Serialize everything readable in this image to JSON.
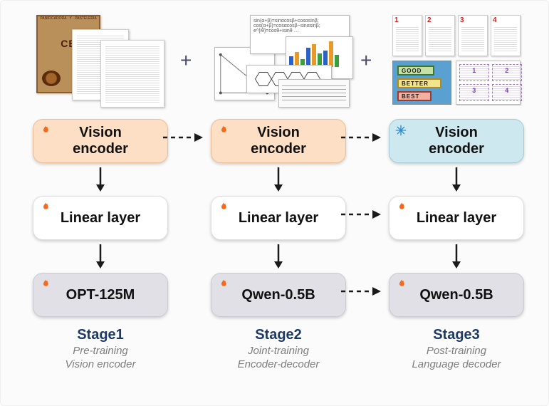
{
  "operators": {
    "plus": "+"
  },
  "stages": [
    {
      "id": "stage1",
      "encoder_label": "Vision\nencoder",
      "encoder_state": "trainable",
      "linear_label": "Linear layer",
      "linear_state": "trainable",
      "decoder_label": "OPT-125M",
      "decoder_state": "trainable",
      "title": "Stage1",
      "caption_line1": "Pre-training",
      "caption_line2": "Vision encoder"
    },
    {
      "id": "stage2",
      "encoder_label": "Vision\nencoder",
      "encoder_state": "trainable",
      "linear_label": "Linear layer",
      "linear_state": "trainable",
      "decoder_label": "Qwen-0.5B",
      "decoder_state": "trainable",
      "title": "Stage2",
      "caption_line1": "Joint-training",
      "caption_line2": "Encoder-decoder"
    },
    {
      "id": "stage3",
      "encoder_label": "Vision\nencoder",
      "encoder_state": "frozen",
      "linear_label": "Linear layer",
      "linear_state": "trainable",
      "decoder_label": "Qwen-0.5B",
      "decoder_state": "trainable",
      "title": "Stage3",
      "caption_line1": "Post-training",
      "caption_line2": "Language decoder"
    }
  ],
  "icons": {
    "flame": "flame-icon",
    "snow": "snowflake-icon"
  },
  "colors": {
    "encoder_warm": "#fcdfc4",
    "encoder_cold": "#cde8ef",
    "linear": "#ffffff",
    "decoder": "#e2e0e7",
    "title": "#1d3a66",
    "flame": "#f26a1b",
    "snow": "#2a8ad4"
  },
  "stage3_pages": [
    "1",
    "2",
    "3",
    "4"
  ],
  "stage3_signpost": [
    "GOOD",
    "BETTER",
    "BEST"
  ],
  "stage3_layout_nums": [
    "1",
    "2",
    "3",
    "4"
  ]
}
